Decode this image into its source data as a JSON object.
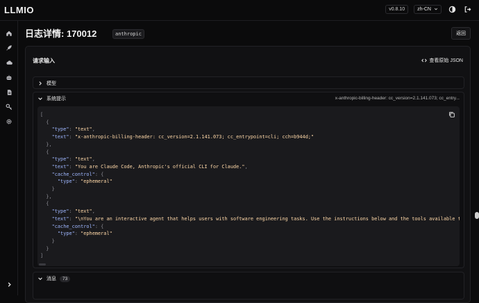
{
  "app": {
    "brand": "LLMIO",
    "version": "v0.8.10",
    "language": "zh-CN"
  },
  "page": {
    "title": "日志详情: 170012",
    "provider": "anthropic",
    "back_label": "返回"
  },
  "card": {
    "title": "请求输入",
    "raw_json_label": "查看原始 JSON"
  },
  "sections": {
    "model": {
      "label": "模型"
    },
    "system": {
      "label": "系统提示",
      "meta": "x-anthropic-billing-header: cc_version=2.1.141.073; cc_entry..."
    },
    "messages": {
      "label": "消息",
      "count": "73"
    }
  },
  "code_lines": [
    {
      "t": [
        [
          "p",
          "["
        ]
      ]
    },
    {
      "t": [
        [
          "p",
          "  {"
        ]
      ]
    },
    {
      "t": [
        [
          "k",
          "    \"type\""
        ],
        [
          "p",
          ": "
        ],
        [
          "s",
          "\"text\""
        ],
        [
          "p",
          ","
        ]
      ]
    },
    {
      "t": [
        [
          "k",
          "    \"text\""
        ],
        [
          "p",
          ": "
        ],
        [
          "s",
          "\"x-anthropic-billing-header: cc_version=2.1.141.073; cc_entrypoint=cli; cch=b944d;\""
        ]
      ]
    },
    {
      "t": [
        [
          "p",
          "  },"
        ]
      ]
    },
    {
      "t": [
        [
          "p",
          "  {"
        ]
      ]
    },
    {
      "t": [
        [
          "k",
          "    \"type\""
        ],
        [
          "p",
          ": "
        ],
        [
          "s",
          "\"text\""
        ],
        [
          "p",
          ","
        ]
      ]
    },
    {
      "t": [
        [
          "k",
          "    \"text\""
        ],
        [
          "p",
          ": "
        ],
        [
          "s",
          "\"You are Claude Code, Anthropic's official CLI for Claude.\""
        ],
        [
          "p",
          ","
        ]
      ]
    },
    {
      "t": [
        [
          "k",
          "    \"cache_control\""
        ],
        [
          "p",
          ": {"
        ]
      ]
    },
    {
      "t": [
        [
          "k",
          "      \"type\""
        ],
        [
          "p",
          ": "
        ],
        [
          "s",
          "\"ephemeral\""
        ]
      ]
    },
    {
      "t": [
        [
          "p",
          "    }"
        ]
      ]
    },
    {
      "t": [
        [
          "p",
          "  },"
        ]
      ]
    },
    {
      "t": [
        [
          "p",
          "  {"
        ]
      ]
    },
    {
      "t": [
        [
          "k",
          "    \"type\""
        ],
        [
          "p",
          ": "
        ],
        [
          "s",
          "\"text\""
        ],
        [
          "p",
          ","
        ]
      ]
    },
    {
      "t": [
        [
          "k",
          "    \"text\""
        ],
        [
          "p",
          ": "
        ],
        [
          "s",
          "\"\\nYou are an interactive agent that helps users with software engineering tasks. Use the instructions below and the tools available to"
        ]
      ]
    },
    {
      "t": [
        [
          "k",
          "    \"cache_control\""
        ],
        [
          "p",
          ": {"
        ]
      ]
    },
    {
      "t": [
        [
          "k",
          "      \"type\""
        ],
        [
          "p",
          ": "
        ],
        [
          "s",
          "\"ephemeral\""
        ]
      ]
    },
    {
      "t": [
        [
          "p",
          "    }"
        ]
      ]
    },
    {
      "t": [
        [
          "p",
          "  }"
        ]
      ]
    },
    {
      "t": [
        [
          "p",
          "]"
        ]
      ]
    }
  ],
  "colors": {
    "background": "#0b0b0c",
    "panel": "#111113",
    "code_bg": "#1a1a1d",
    "key": "#9fb7ff",
    "string": "#ffd8a8"
  }
}
